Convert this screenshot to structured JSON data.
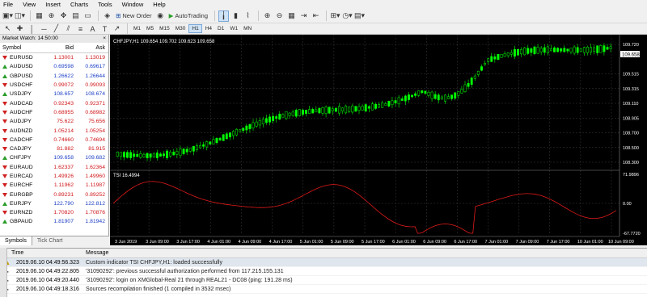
{
  "menu": [
    "File",
    "View",
    "Insert",
    "Charts",
    "Tools",
    "Window",
    "Help"
  ],
  "toolbar": {
    "new_order": "New Order",
    "autotrading": "AutoTrading"
  },
  "timeframes": [
    "M1",
    "M5",
    "M15",
    "M30",
    "H1",
    "H4",
    "D1",
    "W1",
    "MN"
  ],
  "active_timeframe": "H1",
  "market_watch": {
    "title": "Market Watch: 14:50:00",
    "columns": {
      "symbol": "Symbol",
      "bid": "Bid",
      "ask": "Ask"
    },
    "rows": [
      {
        "symbol": "EURUSD",
        "bid": "1.13001",
        "ask": "1.13019",
        "dir": "dn"
      },
      {
        "symbol": "AUDUSD",
        "bid": "0.69598",
        "ask": "0.69617",
        "dir": "up"
      },
      {
        "symbol": "GBPUSD",
        "bid": "1.26622",
        "ask": "1.26644",
        "dir": "up"
      },
      {
        "symbol": "USDCHF",
        "bid": "0.99072",
        "ask": "0.99093",
        "dir": "dn"
      },
      {
        "symbol": "USDJPY",
        "bid": "108.657",
        "ask": "108.674",
        "dir": "up"
      },
      {
        "symbol": "AUDCAD",
        "bid": "0.92343",
        "ask": "0.92371",
        "dir": "dn"
      },
      {
        "symbol": "AUDCHF",
        "bid": "0.68955",
        "ask": "0.68982",
        "dir": "dn"
      },
      {
        "symbol": "AUDJPY",
        "bid": "75.622",
        "ask": "75.656",
        "dir": "dn"
      },
      {
        "symbol": "AUDNZD",
        "bid": "1.05214",
        "ask": "1.05254",
        "dir": "dn"
      },
      {
        "symbol": "CADCHF",
        "bid": "0.74660",
        "ask": "0.74694",
        "dir": "dn"
      },
      {
        "symbol": "CADJPY",
        "bid": "81.882",
        "ask": "81.915",
        "dir": "dn"
      },
      {
        "symbol": "CHFJPY",
        "bid": "109.658",
        "ask": "109.682",
        "dir": "up"
      },
      {
        "symbol": "EURAUD",
        "bid": "1.62337",
        "ask": "1.62364",
        "dir": "dn"
      },
      {
        "symbol": "EURCAD",
        "bid": "1.49926",
        "ask": "1.49960",
        "dir": "dn"
      },
      {
        "symbol": "EURCHF",
        "bid": "1.11962",
        "ask": "1.11987",
        "dir": "dn"
      },
      {
        "symbol": "EURGBP",
        "bid": "0.89231",
        "ask": "0.89252",
        "dir": "dn"
      },
      {
        "symbol": "EURJPY",
        "bid": "122.790",
        "ask": "122.812",
        "dir": "up"
      },
      {
        "symbol": "EURNZD",
        "bid": "1.70820",
        "ask": "1.70876",
        "dir": "dn"
      },
      {
        "symbol": "GBPAUD",
        "bid": "1.81907",
        "ask": "1.81942",
        "dir": "up"
      }
    ],
    "tabs": [
      "Symbols",
      "Tick Chart"
    ]
  },
  "chart": {
    "header": "CHFJPY,H1  109.654 109.702 109.623 109.658",
    "price_labels": [
      "109.720",
      "109.658",
      "109.515",
      "109.315",
      "109.110",
      "108.905",
      "108.700",
      "108.500",
      "108.300"
    ],
    "current_price": "109.658",
    "indicator_header": "TSI 16.4994",
    "indicator_labels": [
      "71.9896",
      "0.00",
      "-67.7720"
    ],
    "time_labels": [
      "3 Jun 2019",
      "3 Jun 09:00",
      "3 Jun 17:00",
      "4 Jun 01:00",
      "4 Jun 09:00",
      "4 Jun 17:00",
      "5 Jun 01:00",
      "5 Jun 09:00",
      "5 Jun 17:00",
      "6 Jun 01:00",
      "6 Jun 09:00",
      "6 Jun 17:00",
      "7 Jun 01:00",
      "7 Jun 09:00",
      "7 Jun 17:00",
      "10 Jun 01:00",
      "10 Jun 09:00"
    ],
    "colors": {
      "background": "#000000",
      "up_candle": "#00ff00",
      "indicator": "#e01a1a",
      "text": "#ffffff",
      "grid": "#3a3a3a"
    }
  },
  "terminal": {
    "columns": {
      "time": "Time",
      "message": "Message"
    },
    "rows": [
      {
        "time": "2019.06.10 04:49:56.323",
        "message": "Custom indicator TSI CHFJPY,H1: loaded successfully",
        "icon": "warning"
      },
      {
        "time": "2019.06.10 04:49:22.805",
        "message": "'31090292': previous successful authorization performed from 117.215.155.131",
        "icon": "info"
      },
      {
        "time": "2019.06.10 04:49:20.440",
        "message": "'31090292': login on XMGlobal-Real 21 through REAL21 - DC08 (ping: 191.28 ms)",
        "icon": "info"
      },
      {
        "time": "2019.06.10 04:49:18.316",
        "message": "Sources recompilation finished (1 compiled in 3532 msec)",
        "icon": "info"
      }
    ]
  }
}
